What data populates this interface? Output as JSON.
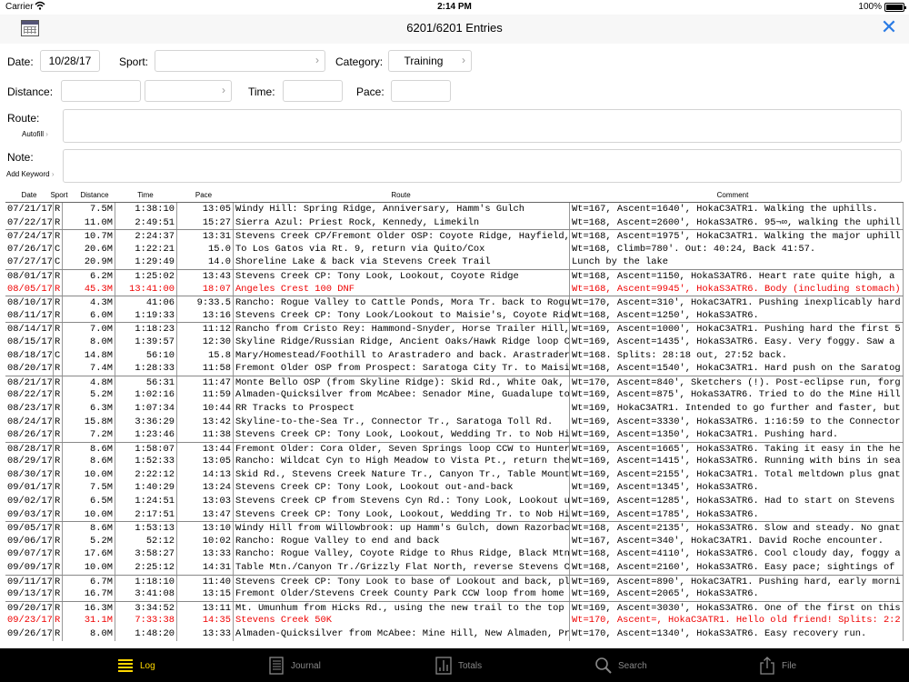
{
  "status": {
    "carrier": "Carrier",
    "time": "2:14 PM",
    "battery": "100%"
  },
  "header": {
    "title": "6201/6201 Entries"
  },
  "form": {
    "date_label": "Date:",
    "date_value": "10/28/17",
    "sport_label": "Sport:",
    "sport_value": "",
    "category_label": "Category:",
    "category_value": "Training",
    "distance_label": "Distance:",
    "distance_value": "",
    "distance_unit": "",
    "time_label": "Time:",
    "time_value": "",
    "pace_label": "Pace:",
    "pace_value": "",
    "route_label": "Route:",
    "autofill_label": "Autofill",
    "route_value": "",
    "note_label": "Note:",
    "add_keyword_label": "Add Keyword",
    "note_value": ""
  },
  "table": {
    "headers": {
      "date": "Date",
      "sport": "Sport",
      "distance": "Distance",
      "time": "Time",
      "pace": "Pace",
      "route": "Route",
      "comment": "Comment"
    },
    "rows": [
      {
        "date": "07/21/17",
        "sport": "R",
        "distance": "7.5M",
        "time": "1:38:10",
        "pace": "13:05",
        "route": "Windy Hill: Spring Ridge, Anniversary, Hamm's Gulch",
        "comment": "Wt=167, Ascent=1640', HokaC3ATR1. Walking the uphills.",
        "sep": false,
        "red": false
      },
      {
        "date": "07/22/17",
        "sport": "R",
        "distance": "11.0M",
        "time": "2:49:51",
        "pace": "15:27",
        "route": "Sierra Azul: Priest Rock, Kennedy, Limekiln",
        "comment": "Wt=168, Ascent=2600', HokaS3ATR6. 95¬∞, walking the uphill",
        "sep": false,
        "red": false
      },
      {
        "date": "07/24/17",
        "sport": "R",
        "distance": "10.7M",
        "time": "2:24:37",
        "pace": "13:31",
        "route": "Stevens Creek CP/Fremont Older OSP: Coyote Ridge, Hayfield,",
        "comment": "Wt=168, Ascent=1975', HokaC3ATR1. Walking the major uphill",
        "sep": true,
        "red": false
      },
      {
        "date": "07/26/17",
        "sport": "C",
        "distance": "20.6M",
        "time": "1:22:21",
        "pace": "15.0",
        "route": "To Los Gatos via Rt. 9, return via Quito/Cox",
        "comment": "Wt=168, Climb=780'. Out: 40:24, Back 41:57.",
        "sep": false,
        "red": false
      },
      {
        "date": "07/27/17",
        "sport": "C",
        "distance": "20.9M",
        "time": "1:29:49",
        "pace": "14.0",
        "route": "Shoreline Lake & back via Stevens Creek Trail",
        "comment": "Lunch by the lake",
        "sep": false,
        "red": false
      },
      {
        "date": "08/01/17",
        "sport": "R",
        "distance": "6.2M",
        "time": "1:25:02",
        "pace": "13:43",
        "route": "Stevens Creek CP: Tony Look, Lookout, Coyote Ridge",
        "comment": "Wt=168, Ascent=1150, HokaS3ATR6. Heart rate quite high, a",
        "sep": true,
        "red": false
      },
      {
        "date": "08/05/17",
        "sport": "R",
        "distance": "45.3M",
        "time": "13:41:00",
        "pace": "18:07",
        "route": "Angeles Crest 100 DNF",
        "comment": "Wt=168, Ascent=9945', HokaS3ATR6. Body (including stomach)",
        "sep": false,
        "red": true
      },
      {
        "date": "08/10/17",
        "sport": "R",
        "distance": "4.3M",
        "time": "41:06",
        "pace": "9:33.5",
        "route": "Rancho: Rogue Valley to Cattle Ponds, Mora Tr. back to Rogu",
        "comment": "Wt=170, Ascent=310', HokaC3ATR1. Pushing inexplicably hard",
        "sep": true,
        "red": false
      },
      {
        "date": "08/11/17",
        "sport": "R",
        "distance": "6.0M",
        "time": "1:19:33",
        "pace": "13:16",
        "route": "Stevens Creek CP: Tony Look/Lookout to Maisie's, Coyote Rid",
        "comment": "Wt=168, Ascent=1250', HokaS3ATR6.",
        "sep": false,
        "red": false
      },
      {
        "date": "08/14/17",
        "sport": "R",
        "distance": "7.0M",
        "time": "1:18:23",
        "pace": "11:12",
        "route": "Rancho from Cristo Rey: Hammond-Snyder, Horse Trailer Hill,",
        "comment": "Wt=169, Ascent=1000', HokaC3ATR1. Pushing hard the first 5",
        "sep": true,
        "red": false
      },
      {
        "date": "08/15/17",
        "sport": "R",
        "distance": "8.0M",
        "time": "1:39:57",
        "pace": "12:30",
        "route": "Skyline Ridge/Russian Ridge, Ancient Oaks/Hawk Ridge loop C",
        "comment": "Wt=169, Ascent=1435', HokaS3ATR6. Easy. Very foggy. Saw a",
        "sep": false,
        "red": false
      },
      {
        "date": "08/18/17",
        "sport": "C",
        "distance": "14.8M",
        "time": "56:10",
        "pace": "15.8",
        "route": "Mary/Homestead/Foothill to Arastradero and back. Arastrader",
        "comment": "Wt=168. Splits:  28:18 out,  27:52 back.",
        "sep": false,
        "red": false
      },
      {
        "date": "08/20/17",
        "sport": "R",
        "distance": "7.4M",
        "time": "1:28:33",
        "pace": "11:58",
        "route": "Fremont Older OSP from Prospect: Saratoga City Tr. to Maisi",
        "comment": "Wt=168, Ascent=1540', HokaC3ATR1. Hard push on the Saratog",
        "sep": false,
        "red": false
      },
      {
        "date": "08/21/17",
        "sport": "R",
        "distance": "4.8M",
        "time": "56:31",
        "pace": "11:47",
        "route": "Monte Bello OSP (from Skyline Ridge): Skid Rd., White Oak,",
        "comment": "Wt=170, Ascent=840', Sketchers (!). Post-eclipse run, forg",
        "sep": true,
        "red": false
      },
      {
        "date": "08/22/17",
        "sport": "R",
        "distance": "5.2M",
        "time": "1:02:16",
        "pace": "11:59",
        "route": "Almaden-Quicksilver from McAbee: Senador Mine, Guadalupe to",
        "comment": "Wt=169, Ascent=875', HokaS3ATR6. Tried to do the Mine Hill",
        "sep": false,
        "red": false
      },
      {
        "date": "08/23/17",
        "sport": "R",
        "distance": "6.3M",
        "time": "1:07:34",
        "pace": "10:44",
        "route": "RR Tracks to Prospect",
        "comment": "Wt=169, HokaC3ATR1. Intended to go further and faster, but",
        "sep": false,
        "red": false
      },
      {
        "date": "08/24/17",
        "sport": "R",
        "distance": "15.8M",
        "time": "3:36:29",
        "pace": "13:42",
        "route": "Skyline-to-the-Sea Tr., Connector Tr., Saratoga Toll Rd.",
        "comment": "Wt=169, Ascent=3330', HokaS3ATR6. 1:16:59 to the Connector",
        "sep": false,
        "red": false
      },
      {
        "date": "08/26/17",
        "sport": "R",
        "distance": "7.2M",
        "time": "1:23:46",
        "pace": "11:38",
        "route": "Stevens Creek CP: Tony Look, Lookout, Wedding Tr. to Nob Hi",
        "comment": "Wt=169, Ascent=1350', HokaC3ATR1. Pushing hard.",
        "sep": false,
        "red": false
      },
      {
        "date": "08/28/17",
        "sport": "R",
        "distance": "8.6M",
        "time": "1:58:07",
        "pace": "13:44",
        "route": "Fremont Older: Cora Older, Seven Springs loop CCW to Hunter",
        "comment": "Wt=169, Ascent=1665', HokaS3ATR6. Taking it easy in the he",
        "sep": true,
        "red": false
      },
      {
        "date": "08/29/17",
        "sport": "R",
        "distance": "8.6M",
        "time": "1:52:33",
        "pace": "13:05",
        "route": "Rancho: Wildcat Cyn to High Meadow to Vista Pt., return the",
        "comment": "Wt=169, Ascent=1415', HokaS3ATR6. Running with bins in sea",
        "sep": false,
        "red": false
      },
      {
        "date": "08/30/17",
        "sport": "R",
        "distance": "10.0M",
        "time": "2:22:12",
        "pace": "14:13",
        "route": "Skid Rd., Stevens Creek Nature Tr., Canyon Tr., Table Mount",
        "comment": "Wt=169, Ascent=2155', HokaC3ATR1. Total meltdown plus gnat",
        "sep": false,
        "red": false
      },
      {
        "date": "09/01/17",
        "sport": "R",
        "distance": "7.5M",
        "time": "1:40:29",
        "pace": "13:24",
        "route": "Stevens Creek CP: Tony Look, Lookout out-and-back",
        "comment": "Wt=169, Ascent=1345', HokaS3ATR6.",
        "sep": false,
        "red": false
      },
      {
        "date": "09/02/17",
        "sport": "R",
        "distance": "6.5M",
        "time": "1:24:51",
        "pace": "13:03",
        "route": "Stevens Creek CP from Stevens Cyn Rd.: Tony Look, Lookout u",
        "comment": "Wt=169, Ascent=1285', HokaS3ATR6. Had to start on Stevens",
        "sep": false,
        "red": false
      },
      {
        "date": "09/03/17",
        "sport": "R",
        "distance": "10.0M",
        "time": "2:17:51",
        "pace": "13:47",
        "route": "Stevens Creek CP: Tony Look, Lookout, Wedding Tr. to Nob Hi",
        "comment": "Wt=169, Ascent=1785', HokaS3ATR6.",
        "sep": false,
        "red": false
      },
      {
        "date": "09/05/17",
        "sport": "R",
        "distance": "8.6M",
        "time": "1:53:13",
        "pace": "13:10",
        "route": "Windy Hill from Willowbrook: up Hamm's Gulch, down Razorbac",
        "comment": "Wt=168, Ascent=2135', HokaS3ATR6. Slow and steady. No gnat",
        "sep": true,
        "red": false
      },
      {
        "date": "09/06/17",
        "sport": "R",
        "distance": "5.2M",
        "time": "52:12",
        "pace": "10:02",
        "route": "Rancho: Rogue Valley to end and back",
        "comment": "Wt=167, Ascent=340', HokaC3ATR1. David Roche encounter.",
        "sep": false,
        "red": false
      },
      {
        "date": "09/07/17",
        "sport": "R",
        "distance": "17.6M",
        "time": "3:58:27",
        "pace": "13:33",
        "route": "Rancho: Rogue Valley, Coyote Ridge to Rhus Ridge, Black Mtn",
        "comment": "Wt=168, Ascent=4110', HokaS3ATR6. Cool cloudy day, foggy a",
        "sep": false,
        "red": false
      },
      {
        "date": "09/09/17",
        "sport": "R",
        "distance": "10.0M",
        "time": "2:25:12",
        "pace": "14:31",
        "route": "Table Mtn./Canyon Tr./Grizzly Flat North, reverse Stevens C",
        "comment": "Wt=168, Ascent=2160', HokaS3ATR6. Easy pace; sightings of",
        "sep": false,
        "red": false
      },
      {
        "date": "09/11/17",
        "sport": "R",
        "distance": "6.7M",
        "time": "1:18:10",
        "pace": "11:40",
        "route": "Stevens Creek CP: Tony Look to base of Lookout and back, pl",
        "comment": "Wt=169, Ascent=890', HokaC3ATR1. Pushing hard, early morni",
        "sep": true,
        "red": false
      },
      {
        "date": "09/13/17",
        "sport": "R",
        "distance": "16.7M",
        "time": "3:41:08",
        "pace": "13:15",
        "route": "Fremont Older/Stevens Creek County Park  CCW loop from home",
        "comment": "Wt=169, Ascent=2065', HokaS3ATR6.",
        "sep": false,
        "red": false
      },
      {
        "date": "09/20/17",
        "sport": "R",
        "distance": "16.3M",
        "time": "3:34:52",
        "pace": "13:11",
        "route": "Mt. Umunhum from Hicks Rd., using the new trail to the top",
        "comment": "Wt=169, Ascent=3030', HokaS3ATR6. One of the first on this",
        "sep": true,
        "red": false
      },
      {
        "date": "09/23/17",
        "sport": "R",
        "distance": "31.1M",
        "time": "7:33:38",
        "pace": "14:35",
        "route": "Stevens Creek 50K",
        "comment": "Wt=170, Ascent=, HokaC3ATR1. Hello old friend! Splits: 2:2",
        "sep": false,
        "red": true
      },
      {
        "date": "09/26/17",
        "sport": "R",
        "distance": "8.0M",
        "time": "1:48:20",
        "pace": "13:33",
        "route": "Almaden-Quicksilver from McAbee: Mine Hill, New Almaden, Pr",
        "comment": "Wt=170, Ascent=1340', HokaS3ATR6. Easy recovery run.",
        "sep": false,
        "red": false
      }
    ]
  },
  "tabs": [
    {
      "label": "Log",
      "icon": "list-icon",
      "active": true
    },
    {
      "label": "Journal",
      "icon": "journal-icon",
      "active": false
    },
    {
      "label": "Totals",
      "icon": "totals-icon",
      "active": false
    },
    {
      "label": "Search",
      "icon": "search-icon",
      "active": false
    },
    {
      "label": "File",
      "icon": "share-icon",
      "active": false
    }
  ],
  "colors": {
    "accent": "#2a7be4",
    "red_entry": "#e00000",
    "tab_active": "#ffd700",
    "tab_inactive": "#888888"
  }
}
